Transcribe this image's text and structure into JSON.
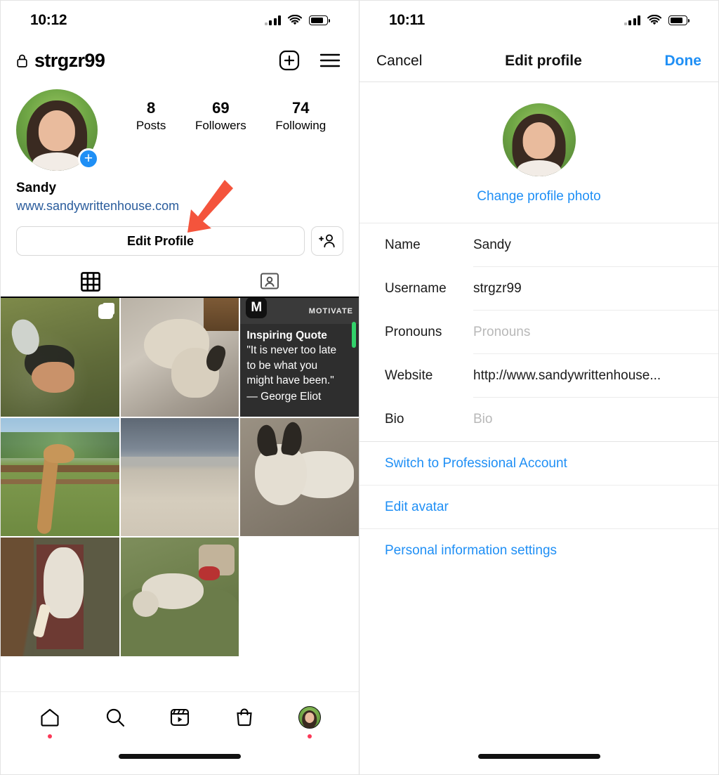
{
  "left_panel": {
    "status_bar": {
      "time": "10:12",
      "icons": [
        "cellular-signal-icon",
        "wifi-icon",
        "battery-icon"
      ]
    },
    "header": {
      "lock_icon": "lock-icon",
      "username": "strgzr99",
      "add_icon": "plus-square-icon",
      "menu_icon": "hamburger-menu-icon"
    },
    "profile": {
      "avatar_alt": "profile-photo",
      "add_story_badge": "+",
      "stats": [
        {
          "num": "8",
          "label": "Posts"
        },
        {
          "num": "69",
          "label": "Followers"
        },
        {
          "num": "74",
          "label": "Following"
        }
      ],
      "display_name": "Sandy",
      "website": "www.sandywrittenhouse.com",
      "edit_profile_button": "Edit Profile",
      "add_user_icon": "add-person-icon"
    },
    "tabs": [
      {
        "name": "grid-tab",
        "icon": "grid-icon",
        "active": true
      },
      {
        "name": "tagged-tab",
        "icon": "tagged-person-icon",
        "active": false
      }
    ],
    "posts": [
      {
        "id": "post-dogs-grass",
        "type": "carousel",
        "badge_icon": "multi-photo-icon"
      },
      {
        "id": "post-dog-on-bed",
        "type": "photo"
      },
      {
        "id": "post-inspiring-quote",
        "type": "photo",
        "app_logo": "M",
        "app_label": "MOTIVATE",
        "heading": "Inspiring Quote",
        "quote": "\"It is never too late to be what you might have been.\"",
        "quote_line1": "\"It is never too late",
        "quote_line2": "to be what you",
        "quote_line3": "might have been.\"",
        "attribution": "— George Eliot"
      },
      {
        "id": "post-giraffe",
        "type": "photo"
      },
      {
        "id": "post-beach",
        "type": "photo"
      },
      {
        "id": "post-dog-on-rock",
        "type": "photo"
      },
      {
        "id": "post-dog-on-couch",
        "type": "photo"
      },
      {
        "id": "post-dog-green-chair",
        "type": "photo"
      }
    ],
    "bottom_nav": [
      {
        "name": "home",
        "icon": "home-icon",
        "dot": true
      },
      {
        "name": "search",
        "icon": "search-icon",
        "dot": false
      },
      {
        "name": "reels",
        "icon": "reels-icon",
        "dot": false
      },
      {
        "name": "shop",
        "icon": "shop-bag-icon",
        "dot": false
      },
      {
        "name": "profile",
        "icon": "profile-avatar-icon",
        "dot": true
      }
    ]
  },
  "right_panel": {
    "status_bar": {
      "time": "10:11",
      "icons": [
        "cellular-signal-icon",
        "wifi-icon",
        "battery-icon"
      ]
    },
    "header": {
      "cancel": "Cancel",
      "title": "Edit profile",
      "done": "Done"
    },
    "photo_block": {
      "avatar_alt": "profile-photo",
      "change_photo_label": "Change profile photo"
    },
    "form": [
      {
        "label": "Name",
        "value": "Sandy",
        "is_placeholder": false
      },
      {
        "label": "Username",
        "value": "strgzr99",
        "is_placeholder": false
      },
      {
        "label": "Pronouns",
        "value": "Pronouns",
        "is_placeholder": true
      },
      {
        "label": "Website",
        "value": "http://www.sandywrittenhouse...",
        "is_placeholder": false
      },
      {
        "label": "Bio",
        "value": "Bio",
        "is_placeholder": true
      }
    ],
    "links": [
      {
        "label": "Switch to Professional Account"
      },
      {
        "label": "Edit avatar"
      },
      {
        "label": "Personal information settings"
      }
    ]
  },
  "annotations": [
    {
      "name": "arrow-to-edit-profile",
      "color": "#F4543C",
      "direction": "down"
    },
    {
      "name": "arrow-to-edit-avatar",
      "color": "#F4543C",
      "direction": "left"
    }
  ],
  "colors": {
    "accent_blue": "#1f8ff5",
    "link_blue": "#2a5c9c",
    "annotation_red": "#F4543C",
    "badge_red": "#fb3958"
  }
}
